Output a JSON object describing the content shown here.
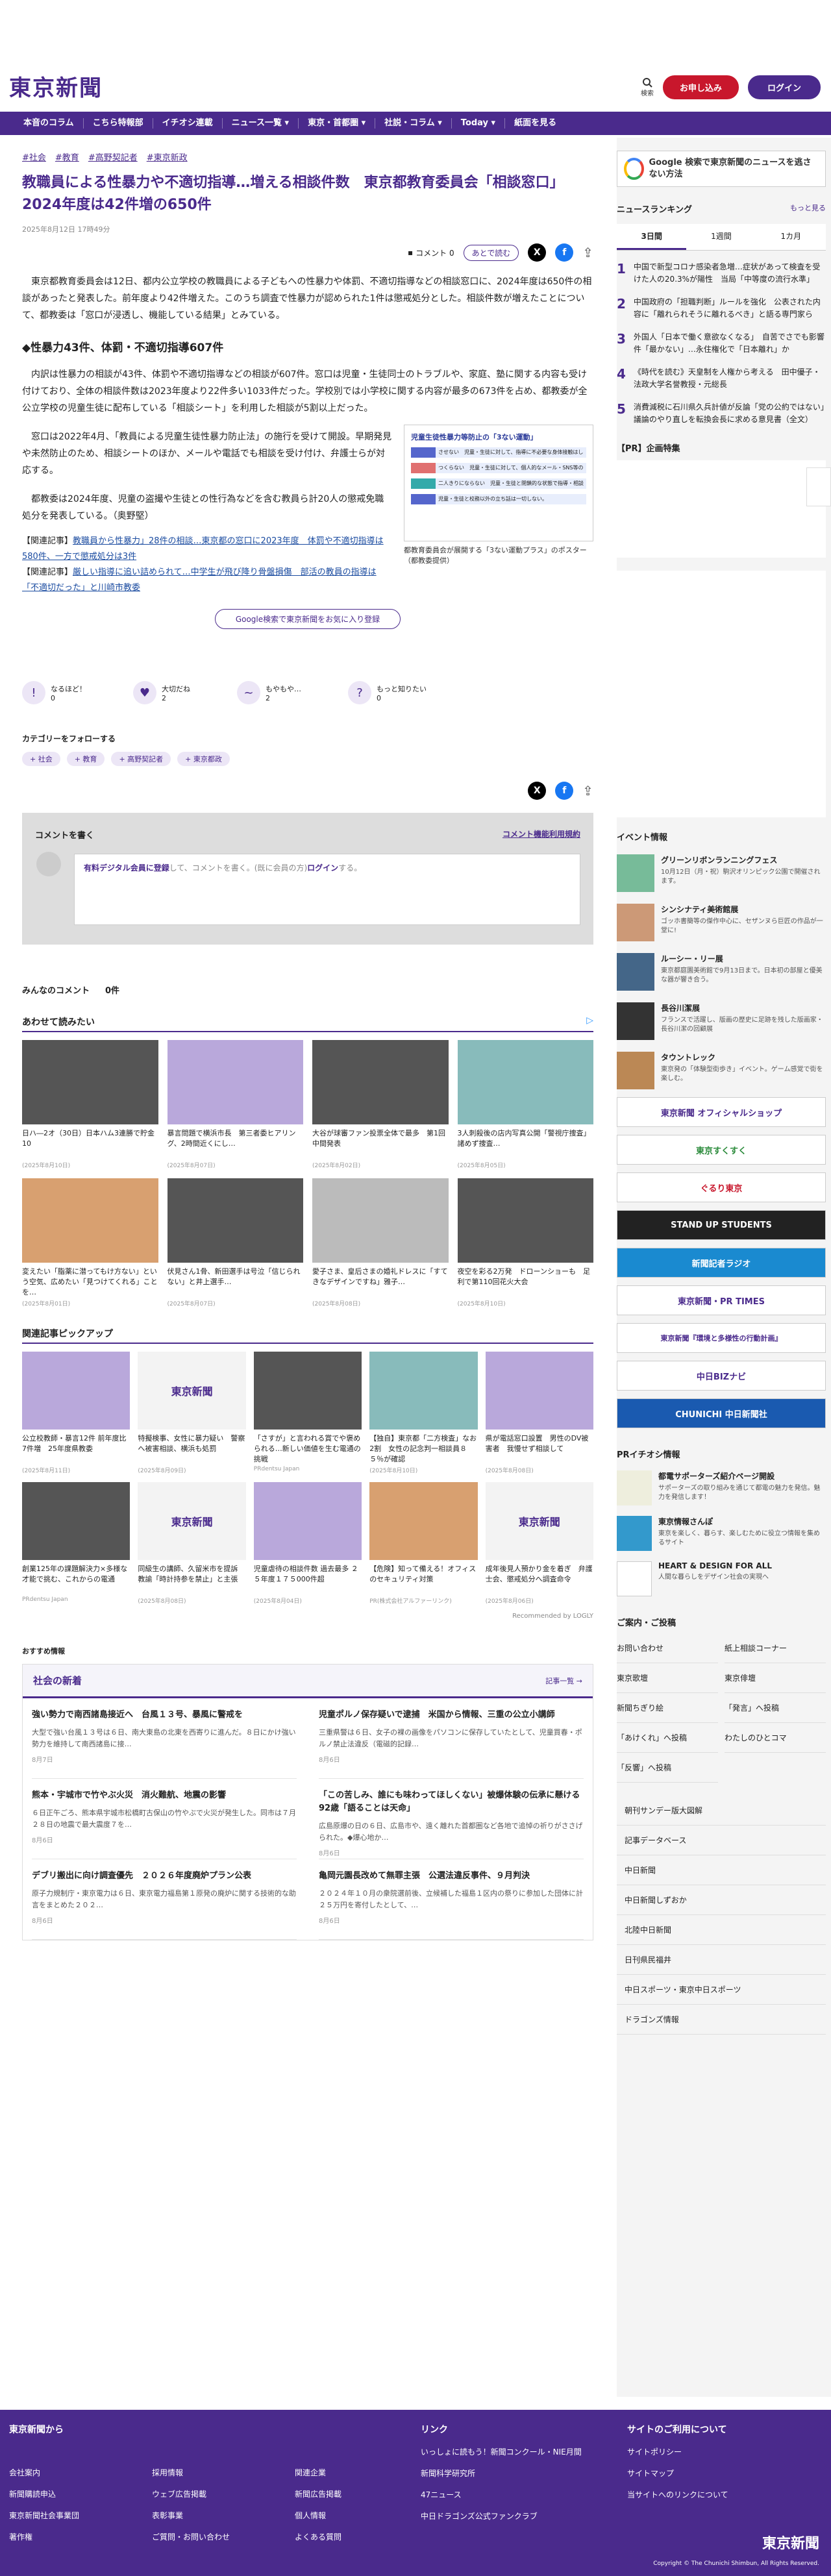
{
  "header": {
    "logo": "東京新聞",
    "search_label": "検索",
    "subscribe": "お申し込み",
    "login": "ログイン"
  },
  "nav": [
    "本音のコラム",
    "こちら特報部",
    "イチオシ連載",
    "ニュース一覧 ▾",
    "東京・首都圏 ▾",
    "社説・コラム ▾",
    "Today ▾",
    "紙面を見る"
  ],
  "article": {
    "tags": [
      "#社会",
      "#教育",
      "#高野契記者",
      "#東京新政"
    ],
    "title": "教職員による性暴力や不適切指導…増える相談件数　東京都教育委員会「相談窓口」2024年度は42件増の650件",
    "date": "2025年8月12日 17時49分",
    "comment_count": "コメント 0",
    "read_later": "あとで読む",
    "paragraphs": [
      "東京都教育委員会は12日、都内公立学校の教職員による子どもへの性暴力や体罰、不適切指導などの相談窓口に、2024年度は650件の相談があったと発表した。前年度より42件増えた。このうち調査で性暴力が認められた1件は懲戒処分とした。相談件数が増えたことについて、都教委は「窓口が浸透し、機能している結果」とみている。"
    ],
    "h2": "◆性暴力43件、体罰・不適切指導607件",
    "paragraphs2": [
      "内訳は性暴力の相談が43件、体罰や不適切指導などの相談が607件。窓口は児童・生徒同士のトラブルや、家庭、塾に関する内容も受け付けており、全体の相談件数は2023年度より22件多い1033件だった。学校別では小学校に関する内容が最多の673件を占め、都教委が全公立学校の児童生徒に配布している「相談シート」を利用した相談が5割以上だった。",
      "窓口は2022年4月、「教員による児童生徒性暴力防止法」の施行を受けて開設。早期発見や未然防止のため、相談シートのほか、メールや電話でも相談を受け付け、弁護士らが対応する。",
      "都教委は2024年度、児童の盗撮や生徒との性行為などを含む教員ら計20人の懲戒免職処分を発表している。（奥野堅）"
    ],
    "figure_caption": "都教育委員会が展開する「3ない運動プラス」のポスター（都教委提供）",
    "figure_title": "児童生徒性暴力等防止の「3ない運動」",
    "figure_rows": [
      "させない　児童・生徒に対して、指導に不必要な身体接触はしない。",
      "つくらない　児童・生徒に対して、個人的なメール・SNS等の送信はしない。",
      "二人きりにならない　児童・生徒と閉鎖的な状態で指導・相談はしない。",
      "児童・生徒と校務以外の立ち話は一切しない。"
    ],
    "related": [
      {
        "label": "【関連記事】",
        "text": "教職員から性暴力」28件の相談…東京都の窓口に2023年度　体罰や不適切指導は580件、一方で懲戒処分は3件"
      },
      {
        "label": "【関連記事】",
        "text": "厳しい指導に追い詰められて…中学生が飛び降り骨盤損傷　部活の教員の指導は「不適切だった」と川崎市教委"
      }
    ],
    "google_follow": "Google検索で東京新聞をお気に入り登録",
    "reactions": [
      {
        "label": "なるほど！",
        "count": "0"
      },
      {
        "label": "大切だね",
        "count": "2"
      },
      {
        "label": "もやもや…",
        "count": "2"
      },
      {
        "label": "もっと知りたい",
        "count": "0"
      }
    ],
    "follow_heading": "カテゴリーをフォローする",
    "categories": [
      "+ 社会",
      "+ 教育",
      "+ 高野契記者",
      "+ 東京都政"
    ]
  },
  "comments": {
    "heading": "コメントを書く",
    "rules": "コメント機能利用規約",
    "prompt_pre": "有料デジタル会員に登録",
    "prompt_mid": "して、コメントを書く。(既に会員の方)",
    "prompt_login": "ログイン",
    "prompt_end": "する。",
    "all_label": "みんなのコメント",
    "all_count": "0件"
  },
  "also_read": {
    "heading": "あわせて読みたい",
    "items": [
      {
        "title": "日ハ―2オ（30日）日本ハム3連勝で貯金10",
        "src": "(2025年8月10日)"
      },
      {
        "title": "暴言問題で横浜市長　第三者委ヒアリング、2時間近くにし…",
        "src": "(2025年8月07日)"
      },
      {
        "title": "大谷が球審ファン投票全体で最多　第1回中間発表",
        "src": "(2025年8月02日)"
      },
      {
        "title": "3人刺殺後の店内写真公開「警視庁捜査」諸めず捜査…",
        "src": "(2025年8月05日)"
      },
      {
        "title": "変えたい「脂薬に潜ってもけ方ない」という空気、広めたい「見つけてくれる」ことを…",
        "src": "(2025年8月01日)"
      },
      {
        "title": "伏見さん1骨、新田選手は号泣「信じられない」と井上選手…",
        "src": "(2025年8月07日)"
      },
      {
        "title": "愛子さま、皇后さまの婚礼ドレスに「すてきなデザインですね」雅子…",
        "src": "(2025年8月08日)"
      },
      {
        "title": "夜空を彩る2万発　ドローンショーも　足利で第110回花火大会",
        "src": "(2025年8月10日)"
      }
    ]
  },
  "pickup": {
    "heading": "関連記事ピックアップ",
    "items": [
      {
        "title": "公立校教師・暴言12件 前年度比7件増　25年度県教委",
        "src": "(2025年8月11日)"
      },
      {
        "title": "特擬検事、女性に暴力疑い　警察へ被害相談、横浜も処罰",
        "src": "(2025年8月09日)"
      },
      {
        "title": "「さすが」と言われる賞でや褒められる…新しい価値を生む電通の挑戦",
        "src": "PRdentsu Japan"
      },
      {
        "title": "【独自】東京都「二方検査」なお2割　女性の記念判一相談員８５％が確認",
        "src": "(2025年8月10日)"
      },
      {
        "title": "県が電話窓口設置　男性のDV被害者　我慢せず相談して",
        "src": "(2025年8月08日)"
      },
      {
        "title": "創業125年の課題解決力×多様な才能で挑む、これからの電通",
        "src": "PRdentsu Japan"
      },
      {
        "title": "同級生の講師、久留米市を提訴　教諭「時計持参を禁止」と主張",
        "src": "(2025年8月08日)"
      },
      {
        "title": "児童虐待の相談件数 過去最多 ２５年度１７５000件超",
        "src": "(2025年8月04日)"
      },
      {
        "title": "【危険】知って備える！オフィスのセキュリティ対策",
        "src": "PR(株式会社アルファーリンク)"
      },
      {
        "title": "成年後見人預かり金を着ぎ　弁護士会、懲戒処分へ調査命令",
        "src": "(2025年8月06日)"
      }
    ],
    "recommended": "Recommended by LOGLY"
  },
  "osusume": "おすすめ情報",
  "social": {
    "heading": "社会の新着",
    "more": "記事一覧 →",
    "items": [
      {
        "title": "強い勢力で南西諸島接近へ　台風１３号、暴風に警戒を",
        "desc": "大型で強い台風１３号は６日、南大東島の北東を西寄りに進んだ。８日にかけ強い勢力を維持して南西諸島に接…",
        "date": "8月7日"
      },
      {
        "title": "児童ポルノ保存疑いで逮捕　米国から情報、三重の公立小講師",
        "desc": "三重県警は６日、女子の裸の画像をパソコンに保存していたとして、児童買春・ポルノ禁止法違反（電磁的記録…",
        "date": "8月6日"
      },
      {
        "title": "熊本・宇城市で竹やぶ火災　消火難航、地震の影響",
        "desc": "６日正午ごろ、熊本県宇城市松橋町古保山の竹やぶで火災が発生した。同市は７月２８日の地震で最大震度７を…",
        "date": "8月6日"
      },
      {
        "title": "「この苦しみ、誰にも味わってほしくない」被爆体験の伝承に懸ける92歳「語ることは天命」",
        "desc": "広島原爆の日の６日、広島市や、遠く離れた首都圏など各地で追悼の祈りがささげられた。◆爆心地か…",
        "date": "8月6日"
      },
      {
        "title": "デブリ搬出に向け調査優先　２０２６年度廃炉プラン公表",
        "desc": "原子力規制庁・東京電力は６日、東京電力福島第１原発の廃炉に関する技術的な助言をまとめた２０２…",
        "date": "8月6日"
      },
      {
        "title": "亀岡元園長改めて無罪主張　公選法違反事件、９月判決",
        "desc": "２０２４年１０月の衆院選前後、立候補した福島１区内の祭りに参加した団体に計２５万円を寄付したとして、…",
        "date": "8月6日"
      }
    ]
  },
  "sidebar": {
    "google_banner": "Google 検索で東京新聞のニュースを逃さない方法",
    "ranking_heading": "ニュースランキング",
    "ranking_more": "もっと見る",
    "tabs": [
      "3日間",
      "1週間",
      "1カ月"
    ],
    "ranking": [
      "中国で新型コロナ感染者急増…症状があって検査を受けた人の20.3%が陽性　当局「中等度の流行水準」",
      "中国政府の「担職判断」ルールを強化　公表された内容に「離れられそうに離れるべき」と語る専門家ら",
      "外国人「日本で働く意欲なくなる」　自苦でさでも影響件「最かない」…永住権化で「日本離れ」か",
      "《時代を読む》天皇制を人権から考える　田中優子・法政大学名誉教授・元総長",
      "消費減税に石川県久兵計値が反論「党の公約ではない」　議論のやり直しを転換会長に求める意見書（全文）"
    ],
    "pr_heading": "【PR】企画特集",
    "events_heading": "イベント情報",
    "events": [
      {
        "title": "グリーンリボンランニングフェス",
        "desc": "10月12日（月・祝）駒沢オリンピック公園で開催されます。"
      },
      {
        "title": "シンシナティ美術館展",
        "desc": "ゴッホ書簡等の傑作中心に、セザンヌら巨匠の作品が一堂に!"
      },
      {
        "title": "ルーシー・リー展",
        "desc": "東京都庭園美術館で9月13日まで。日本初の部屋と優美な器が響き合う。"
      },
      {
        "title": "長谷川潔展",
        "desc": "フランスで活躍し、版画の歴史に足跡を残した版画家・長谷川潔の回顧展"
      },
      {
        "title": "タウントレック",
        "desc": "東京発の「体験型街歩き」イベント。ゲーム感覚で街を楽しむ。"
      }
    ],
    "banners": [
      "東京新聞 オフィシャルショップ",
      "東京すくすく",
      "ぐるり東京",
      "STAND UP STUDENTS",
      "新聞記者ラジオ",
      "東京新聞・PR TIMES",
      "東京新聞『環境と多様性の行動計画』",
      "中日BIZナビ",
      "CHUNICHI 中日新聞社"
    ],
    "pr_recommend": "PRイチオシ情報",
    "pr_items": [
      {
        "title": "都電サポーターズ紹介ページ開設",
        "desc": "サポーターズの取り組みを通じて都電の魅力を発信。魅力を発信します！"
      },
      {
        "title": "東京情報さんぽ",
        "desc": "東京を楽しく、暮らす、楽しむために役立つ情報を集めるサイト"
      },
      {
        "title": "HEART & DESIGN FOR ALL",
        "desc": "人間な暮らしをデザイン社会の実現へ"
      }
    ],
    "guide_heading": "ご案内・ご投稿",
    "guide": [
      "お問い合わせ",
      "紙上相談コーナー",
      "東京歌壇",
      "東京俳壇",
      "新聞ちぎり絵",
      "「発言」へ投稿",
      "「あけくれ」へ投稿",
      "わたしのひとコマ",
      "「反響」へ投稿"
    ],
    "links": [
      "朝刊サンデー版大図解",
      "記事データベース",
      "中日新聞",
      "中日新聞しずおか",
      "北陸中日新聞",
      "日刊県民福井",
      "中日スポーツ・東京中日スポーツ",
      "ドラゴンズ情報"
    ]
  },
  "footer": {
    "col1_h": "東京新聞から",
    "col1": [
      "会社案内",
      "新聞購読申込",
      "東京新聞社会事業団",
      "著作権",
      "採用情報",
      "ウェブ広告掲載",
      "表彰事業",
      "ご質問・お問い合わせ",
      "関連企業",
      "新聞広告掲載",
      "個人情報",
      "よくある質問"
    ],
    "col2_h": "リンク",
    "col2": [
      "いっしょに読もう！新聞コンクール・NIE月間",
      "新聞科学研究所",
      "47ニュース",
      "中日ドラゴンズ公式ファンクラブ"
    ],
    "col3_h": "サイトのご利用について",
    "col3": [
      "サイトポリシー",
      "サイトマップ",
      "当サイトへのリンクについて"
    ],
    "logo": "東京新聞",
    "copyright": "Copyright © The Chunichi Shimbun, All Rights Reserved."
  }
}
